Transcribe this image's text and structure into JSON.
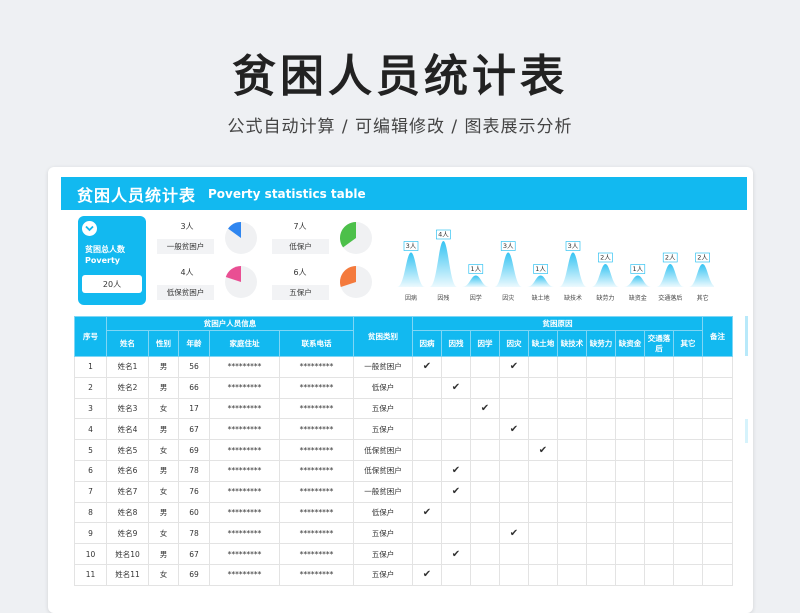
{
  "hero": {
    "title": "贫困人员统计表",
    "subtitle": "公式自动计算 /  可编辑修改  / 图表展示分析"
  },
  "sheet": {
    "title": "贫困人员统计表",
    "subtitle": "Poverty statistics table"
  },
  "summary": {
    "total_label": "贫困总人数 Poverty",
    "total_value": "20人",
    "categories": [
      {
        "count": "3人",
        "label": "一般贫困户",
        "fraction": 0.15,
        "color": "#2f86f0"
      },
      {
        "count": "7人",
        "label": "低保户",
        "fraction": 0.35,
        "color": "#4cc04a"
      },
      {
        "count": "4人",
        "label": "低保贫困户",
        "fraction": 0.2,
        "color": "#e94f93"
      },
      {
        "count": "6人",
        "label": "五保户",
        "fraction": 0.3,
        "color": "#f47a3d"
      }
    ]
  },
  "chart_data": {
    "type": "area",
    "categories": [
      "因病",
      "因残",
      "因学",
      "因灾",
      "缺土地",
      "缺技术",
      "缺劳力",
      "缺资金",
      "交通落后",
      "其它"
    ],
    "values": [
      3,
      4,
      1,
      3,
      1,
      3,
      2,
      1,
      2,
      2
    ],
    "data_labels": [
      "3人",
      "4人",
      "1人",
      "3人",
      "1人",
      "3人",
      "2人",
      "1人",
      "2人",
      "2人"
    ],
    "ylim": [
      0,
      4
    ],
    "grid": false,
    "color": "#12b9f0"
  },
  "table": {
    "group_headers": {
      "seq": "序号",
      "info": "贫困户人员信息",
      "type": "贫困类别",
      "reason": "贫困原因",
      "note": "备注"
    },
    "info_columns": [
      "姓名",
      "性别",
      "年龄",
      "家庭住址",
      "联系电话"
    ],
    "reason_columns": [
      "因病",
      "因残",
      "因学",
      "因灾",
      "缺土地",
      "缺技术",
      "缺劳力",
      "缺资金",
      "交通落后",
      "其它"
    ],
    "check_mark": "✔",
    "rows": [
      {
        "seq": "1",
        "name": "姓名1",
        "gender": "男",
        "age": "56",
        "address": "*********",
        "phone": "*********",
        "type": "一般贫困户",
        "reason_index": [
          0,
          3
        ]
      },
      {
        "seq": "2",
        "name": "姓名2",
        "gender": "男",
        "age": "66",
        "address": "*********",
        "phone": "*********",
        "type": "低保户",
        "reason_index": [
          1
        ]
      },
      {
        "seq": "3",
        "name": "姓名3",
        "gender": "女",
        "age": "17",
        "address": "*********",
        "phone": "*********",
        "type": "五保户",
        "reason_index": [
          2
        ]
      },
      {
        "seq": "4",
        "name": "姓名4",
        "gender": "男",
        "age": "67",
        "address": "*********",
        "phone": "*********",
        "type": "五保户",
        "reason_index": [
          3
        ]
      },
      {
        "seq": "5",
        "name": "姓名5",
        "gender": "女",
        "age": "69",
        "address": "*********",
        "phone": "*********",
        "type": "低保贫困户",
        "reason_index": [
          4
        ]
      },
      {
        "seq": "6",
        "name": "姓名6",
        "gender": "男",
        "age": "78",
        "address": "*********",
        "phone": "*********",
        "type": "低保贫困户",
        "reason_index": [
          1
        ]
      },
      {
        "seq": "7",
        "name": "姓名7",
        "gender": "女",
        "age": "76",
        "address": "*********",
        "phone": "*********",
        "type": "一般贫困户",
        "reason_index": [
          1
        ]
      },
      {
        "seq": "8",
        "name": "姓名8",
        "gender": "男",
        "age": "60",
        "address": "*********",
        "phone": "*********",
        "type": "低保户",
        "reason_index": [
          0
        ]
      },
      {
        "seq": "9",
        "name": "姓名9",
        "gender": "女",
        "age": "78",
        "address": "*********",
        "phone": "*********",
        "type": "五保户",
        "reason_index": [
          3
        ]
      },
      {
        "seq": "10",
        "name": "姓名10",
        "gender": "男",
        "age": "67",
        "address": "*********",
        "phone": "*********",
        "type": "五保户",
        "reason_index": [
          1
        ]
      },
      {
        "seq": "11",
        "name": "姓名11",
        "gender": "女",
        "age": "69",
        "address": "*********",
        "phone": "*********",
        "type": "五保户",
        "reason_index": [
          0
        ]
      }
    ]
  },
  "colors": {
    "accent": "#12b9f0"
  }
}
